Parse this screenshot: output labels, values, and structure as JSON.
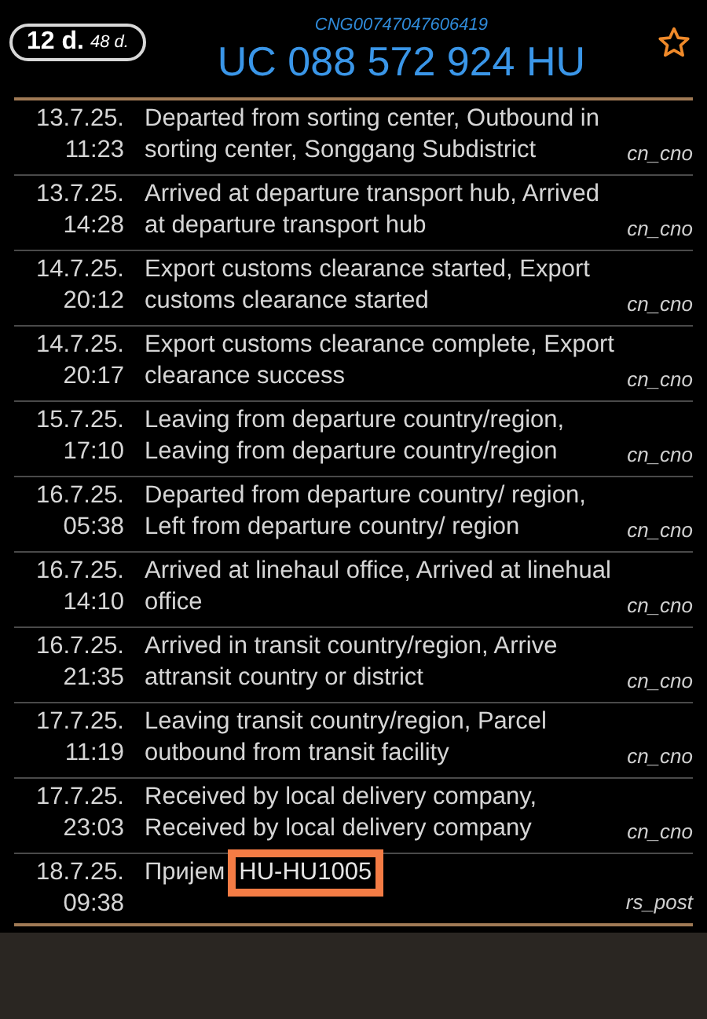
{
  "header": {
    "days_badge": {
      "days": "12 d.",
      "total": "48 d."
    },
    "reference": "CNG00747047606419",
    "tracking_number": "UC 088 572 924 HU",
    "starred": false
  },
  "events": [
    {
      "date": "13.7.25.",
      "time": "11:23",
      "text": "Departed from sorting center, Outbound in sorting center, Songgang Subdistrict",
      "source": "cn_cno"
    },
    {
      "date": "13.7.25.",
      "time": "14:28",
      "text": "Arrived at departure transport hub, Arrived at departure transport hub",
      "source": "cn_cno"
    },
    {
      "date": "14.7.25.",
      "time": "20:12",
      "text": "Export customs clearance started, Export customs clearance started",
      "source": "cn_cno"
    },
    {
      "date": "14.7.25.",
      "time": "20:17",
      "text": "Export customs clearance complete, Export clearance success",
      "source": "cn_cno"
    },
    {
      "date": "15.7.25.",
      "time": "17:10",
      "text": "Leaving from departure country/region, Leaving from departure country/region",
      "source": "cn_cno"
    },
    {
      "date": "16.7.25.",
      "time": "05:38",
      "text": "Departed from departure country/ region, Left from departure country/ region",
      "source": "cn_cno"
    },
    {
      "date": "16.7.25.",
      "time": "14:10",
      "text": "Arrived at linehaul office, Arrived at linehual office",
      "source": "cn_cno"
    },
    {
      "date": "16.7.25.",
      "time": "21:35",
      "text": "Arrived in transit country/region, Arrive attransit country or district",
      "source": "cn_cno"
    },
    {
      "date": "17.7.25.",
      "time": "11:19",
      "text": "Leaving transit country/region, Parcel outbound from transit facility",
      "source": "cn_cno"
    },
    {
      "date": "17.7.25.",
      "time": "23:03",
      "text": "Received by local delivery company, Received by local delivery company",
      "source": "cn_cno"
    },
    {
      "date": "18.7.25.",
      "time": "09:38",
      "text": "Пријем",
      "highlighted_text": "HU-HU1005",
      "source": "rs_post"
    }
  ]
}
